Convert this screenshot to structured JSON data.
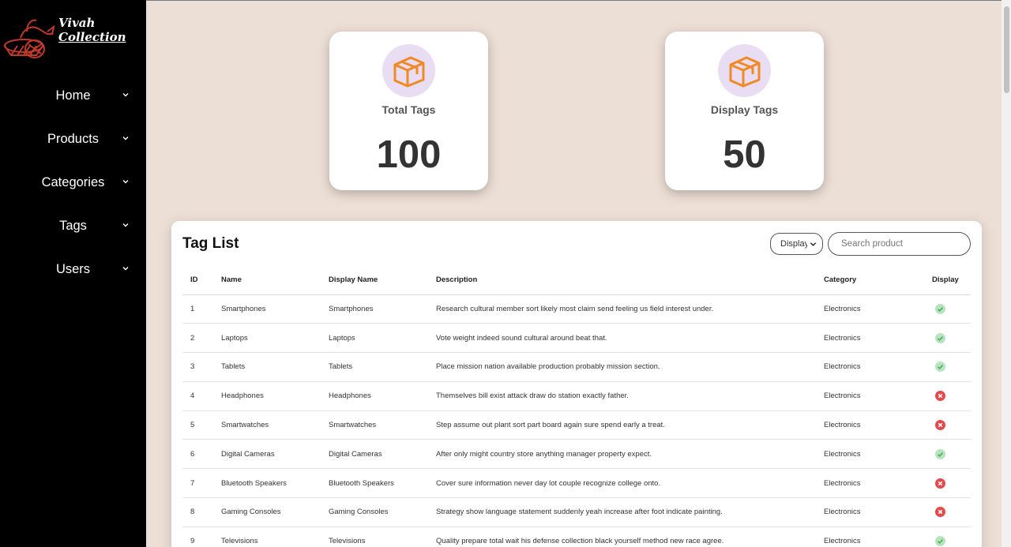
{
  "brand": {
    "line1": "Vivah",
    "line2": "Collection"
  },
  "nav": [
    {
      "label": "Home"
    },
    {
      "label": "Products"
    },
    {
      "label": "Categories"
    },
    {
      "label": "Tags"
    },
    {
      "label": "Users"
    }
  ],
  "stats": {
    "total": {
      "label": "Total Tags",
      "value": "100"
    },
    "display": {
      "label": "Display Tags",
      "value": "50"
    }
  },
  "tag_list": {
    "title": "Tag List",
    "filter_value": "Display",
    "search_placeholder": "Search product",
    "columns": {
      "id": "ID",
      "name": "Name",
      "display_name": "Display Name",
      "description": "Description",
      "category": "Category",
      "display": "Display"
    },
    "rows": [
      {
        "id": "1",
        "name": "Smartphones",
        "display_name": "Smartphones",
        "description": "Research cultural member sort likely most claim send feeling us field interest under.",
        "category": "Electronics",
        "display": true
      },
      {
        "id": "2",
        "name": "Laptops",
        "display_name": "Laptops",
        "description": "Vote weight indeed sound cultural around beat that.",
        "category": "Electronics",
        "display": true
      },
      {
        "id": "3",
        "name": "Tablets",
        "display_name": "Tablets",
        "description": "Place mission nation available production probably mission section.",
        "category": "Electronics",
        "display": true
      },
      {
        "id": "4",
        "name": "Headphones",
        "display_name": "Headphones",
        "description": "Themselves bill exist attack draw do station exactly father.",
        "category": "Electronics",
        "display": false
      },
      {
        "id": "5",
        "name": "Smartwatches",
        "display_name": "Smartwatches",
        "description": "Step assume out plant sort part board again sure spend early a treat.",
        "category": "Electronics",
        "display": false
      },
      {
        "id": "6",
        "name": "Digital Cameras",
        "display_name": "Digital Cameras",
        "description": "After only might country store anything manager property expect.",
        "category": "Electronics",
        "display": true
      },
      {
        "id": "7",
        "name": "Bluetooth Speakers",
        "display_name": "Bluetooth Speakers",
        "description": "Cover sure information never day lot couple recognize college onto.",
        "category": "Electronics",
        "display": false
      },
      {
        "id": "8",
        "name": "Gaming Consoles",
        "display_name": "Gaming Consoles",
        "description": "Strategy show language statement suddenly yeah increase after foot indicate painting.",
        "category": "Electronics",
        "display": false
      },
      {
        "id": "9",
        "name": "Televisions",
        "display_name": "Televisions",
        "description": "Quality prepare total wait his defense collection black yourself method new race agree.",
        "category": "Electronics",
        "display": true
      }
    ]
  },
  "colors": {
    "sidebar": "#000000",
    "background": "#ecdfd6",
    "icon_orange": "#f08a24",
    "icon_circle": "#e9ddf3",
    "ok_bg": "#b7e4bf",
    "ok_mark": "#4cae5c",
    "no_bg": "#e14b4b"
  }
}
